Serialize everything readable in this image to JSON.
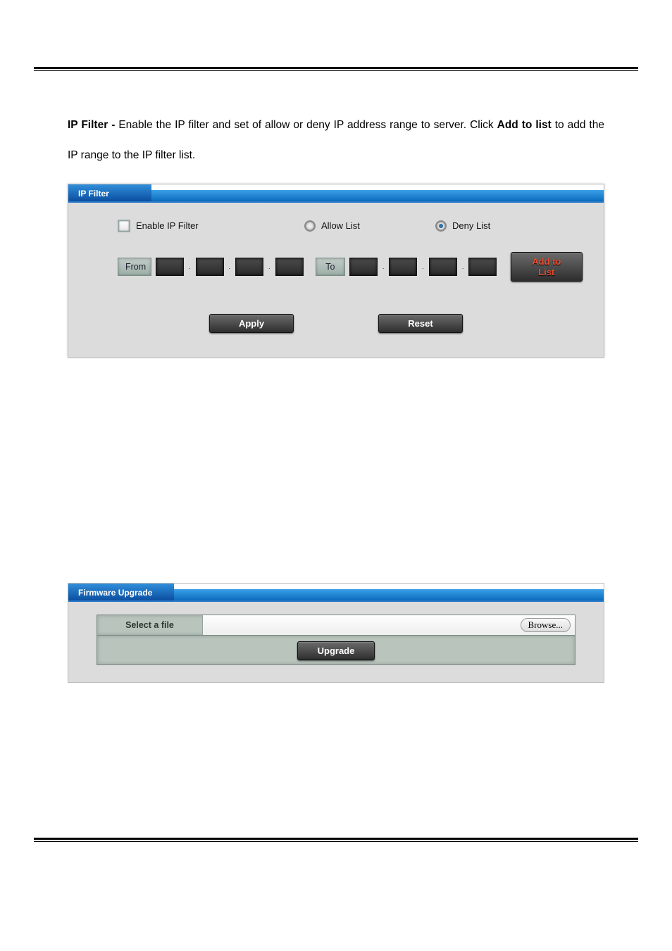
{
  "text": {
    "ipfilter_label": "IP Filter - ",
    "ipfilter_desc": "Enable the IP filter and set of allow or deny IP address range to server. Click ",
    "addtolist_bold": "Add to list",
    "ipfilter_desc2": " to add the IP range to the IP filter list."
  },
  "ipfilter": {
    "tab": "IP Filter",
    "enable_label": "Enable IP Filter",
    "allow_label": "Allow List",
    "deny_label": "Deny List",
    "from_label": "From",
    "to_label": "To",
    "add_button": "Add to List",
    "apply_button": "Apply",
    "reset_button": "Reset"
  },
  "firmware": {
    "tab": "Firmware Upgrade",
    "select_label": "Select a file",
    "browse_button": "Browse...",
    "upgrade_button": "Upgrade"
  }
}
